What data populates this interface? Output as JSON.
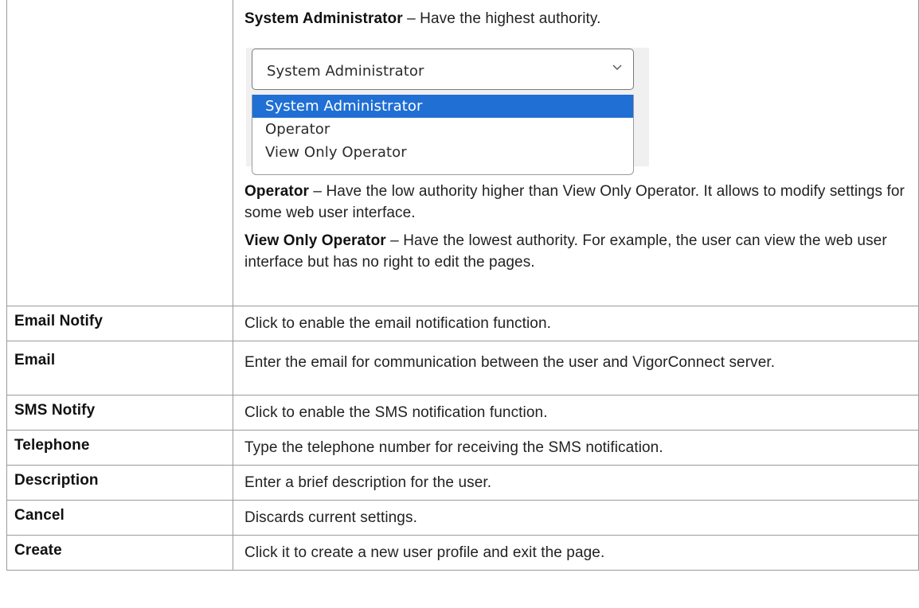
{
  "roles": {
    "sysadmin": {
      "name": "System Administrator",
      "desc": " – Have the highest authority."
    },
    "operator": {
      "name": "Operator",
      "desc": " – Have the low authority higher than View Only Operator. It allows to modify settings for some web user interface."
    },
    "viewonly": {
      "name": "View Only Operator",
      "desc": " – Have the lowest authority. For example, the user can view the web user interface but has no right to edit the pages."
    }
  },
  "select_demo": {
    "value": "System Administrator",
    "options": [
      "System Administrator",
      "Operator",
      "View Only Operator"
    ],
    "selected_color": "#1f6fd4"
  },
  "rows": [
    {
      "label": "Email Notify",
      "desc": "Click to enable the email notification function."
    },
    {
      "label": "Email",
      "desc": "Enter the email for communication between the user and VigorConnect server."
    },
    {
      "label": "SMS Notify",
      "desc": "Click to enable the SMS notification function."
    },
    {
      "label": "Telephone",
      "desc": "Type the telephone number for receiving the SMS notification."
    },
    {
      "label": "Description",
      "desc": "Enter a brief description for the user."
    },
    {
      "label": "Cancel",
      "desc": "Discards current settings."
    },
    {
      "label": "Create",
      "desc": "Click it to create a new user profile and exit the page."
    }
  ]
}
